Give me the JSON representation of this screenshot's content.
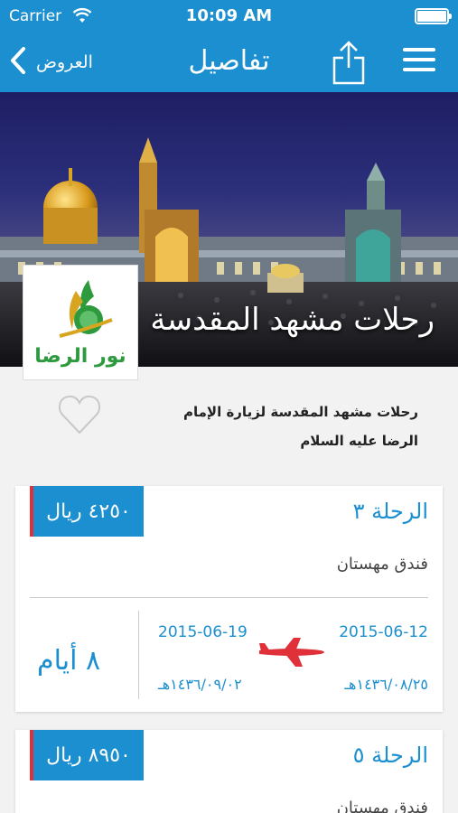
{
  "status_bar": {
    "carrier": "Carrier",
    "time": "10:09 AM"
  },
  "nav": {
    "back_label": "العروض",
    "title": "تفاصيل"
  },
  "hero": {
    "title": "رحلات مشهد المقدسة",
    "logo_text": "نور الرضا"
  },
  "description": {
    "line1": "رحلات مشهد المقدسة لزيارة الإمام",
    "line2": "الرضا عليه السلام"
  },
  "trips": [
    {
      "name": "الرحلة ٣",
      "price": "٤٢٥٠ ريال",
      "hotel": "فندق مهستان",
      "depart_date": "2015-06-12",
      "depart_hijri": "١٤٣٦/٠٨/٢٥هـ",
      "return_date": "2015-06-19",
      "return_hijri": "١٤٣٦/٠٩/٠٢هـ",
      "duration": "٨ أيام"
    },
    {
      "name": "الرحلة ٥",
      "price": "٨٩٥٠ ريال",
      "hotel": "فندق مهستان"
    }
  ],
  "colors": {
    "primary": "#1b8fd0",
    "accent": "#e0303a",
    "logo_green": "#2e9a3e",
    "logo_gold": "#d8a520"
  }
}
